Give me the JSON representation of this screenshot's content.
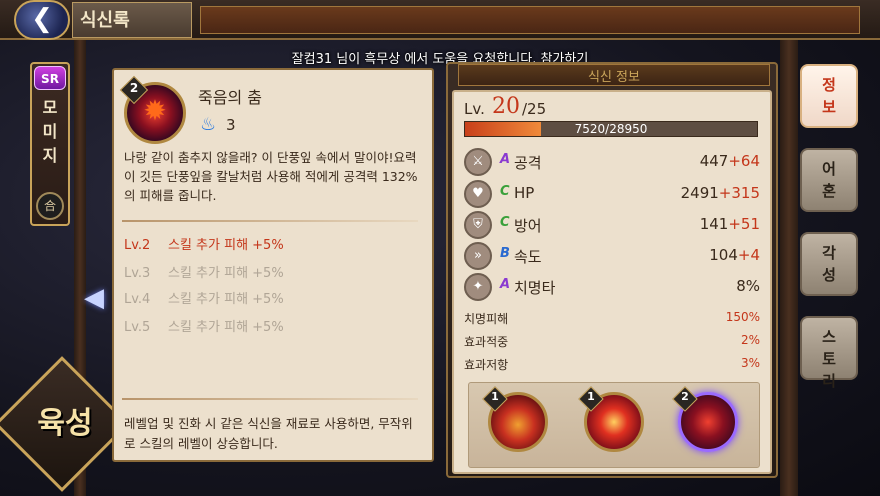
{
  "colors": {
    "accent_red": "#c4361a",
    "panel_bg": "#ece0cd",
    "frame_gold": "#c9a45a",
    "exp_bar": "#f08a3a"
  },
  "header": {
    "title": "식신록",
    "back_icon": "back-arrow-icon"
  },
  "notice": "잘컴31 님이 흑무상 에서 도움을 요청합니다. 참가하기",
  "character": {
    "rarity": "SR",
    "name": "모\n미\n지",
    "badge": "合"
  },
  "grow_label": "육성",
  "skill": {
    "level": "2",
    "name": "죽음의 춤",
    "cost": "3",
    "description": "나랑 같이 춤추지 않을래? 이 단풍잎 속에서 말이야!요력이 깃든 단풍잎을 칼날처럼 사용해 적에게 공격력 132%의 피해를 줍니다.",
    "levels": [
      {
        "lv": "Lv.2",
        "text": "스킬 추가 피해 +5%",
        "active": true
      },
      {
        "lv": "Lv.3",
        "text": "스킬 추가 피해 +5%",
        "active": false
      },
      {
        "lv": "Lv.4",
        "text": "스킬 추가 피해 +5%",
        "active": false
      },
      {
        "lv": "Lv.5",
        "text": "스킬 추가 피해 +5%",
        "active": false
      }
    ],
    "footer": "레벨업 및 진화 시 같은 식신을 재료로 사용하면, 무작위로 스킬의 레벨이 상승합니다."
  },
  "info": {
    "title": "식신 정보",
    "lv_label": "Lv.",
    "lv_current": "20",
    "lv_max": "/25",
    "exp_text": "7520/28950",
    "exp_fraction": 0.26,
    "stats": [
      {
        "icon": "sword-icon",
        "grade": "A",
        "name": "공격",
        "base": "447",
        "bonus": "+64"
      },
      {
        "icon": "heart-icon",
        "grade": "C",
        "name": "HP",
        "base": "2491",
        "bonus": "+315"
      },
      {
        "icon": "shield-icon",
        "grade": "C",
        "name": "방어",
        "base": "141",
        "bonus": "+51"
      },
      {
        "icon": "speed-icon",
        "grade": "B",
        "name": "속도",
        "base": "104",
        "bonus": "+4"
      },
      {
        "icon": "crit-icon",
        "grade": "A",
        "name": "치명타",
        "base": "8%",
        "bonus": ""
      }
    ],
    "substats": [
      {
        "name": "치명피해",
        "value": "150%"
      },
      {
        "name": "효과적중",
        "value": "2%"
      },
      {
        "name": "효과저항",
        "value": "3%"
      }
    ],
    "skill_slots": [
      {
        "level": "1",
        "icon": "flame-burst-icon"
      },
      {
        "level": "1",
        "icon": "explosion-icon"
      },
      {
        "level": "2",
        "icon": "maple-leaf-icon"
      }
    ]
  },
  "tabs": [
    {
      "label": "정\n보",
      "active": true
    },
    {
      "label": "어\n혼",
      "active": false
    },
    {
      "label": "각\n성",
      "active": false
    },
    {
      "label": "스\n토\n리",
      "active": false
    }
  ]
}
